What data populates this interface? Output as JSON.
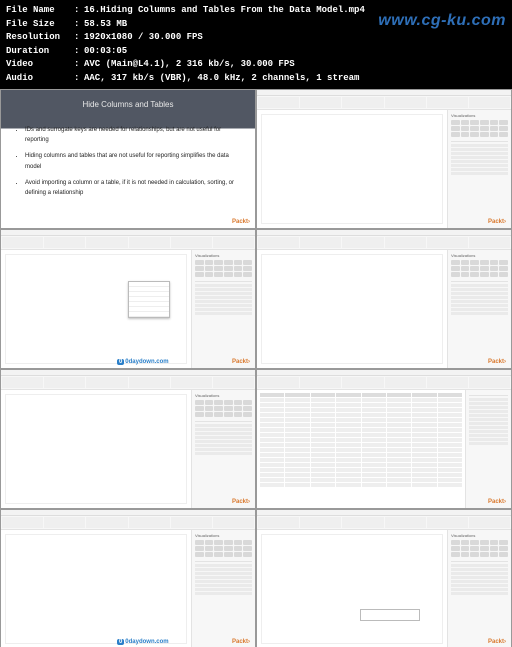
{
  "watermark": "www.cg-ku.com",
  "meta": {
    "labels": {
      "file_name": "File Name",
      "file_size": "File Size",
      "resolution": "Resolution",
      "duration": "Duration",
      "video": "Video",
      "audio": "Audio"
    },
    "values": {
      "file_name": "16.Hiding Columns and Tables From the Data Model.mp4",
      "file_size": "58.53 MB",
      "resolution": "1920x1080 / 30.000 FPS",
      "duration": "00:03:05",
      "video": "AVC (Main@L4.1), 2 316 kb/s, 30.000 FPS",
      "audio": "AAC, 317 kb/s (VBR), 48.0 kHz, 2 channels, 1 stream"
    }
  },
  "slide": {
    "title": "Hide Columns and Tables",
    "bullets": [
      "IDs and surrogate keys are needed for relationships, but are not useful for reporting",
      "Hiding columns and tables that are not useful for reporting simplifies the data model",
      "Avoid importing a column or a table, if it is not needed in calculation, sorting, or defining a relationship"
    ]
  },
  "brand": {
    "packt": "Packt›",
    "zdaydown": "0daydown.com",
    "viz_label": "Visualizations"
  }
}
